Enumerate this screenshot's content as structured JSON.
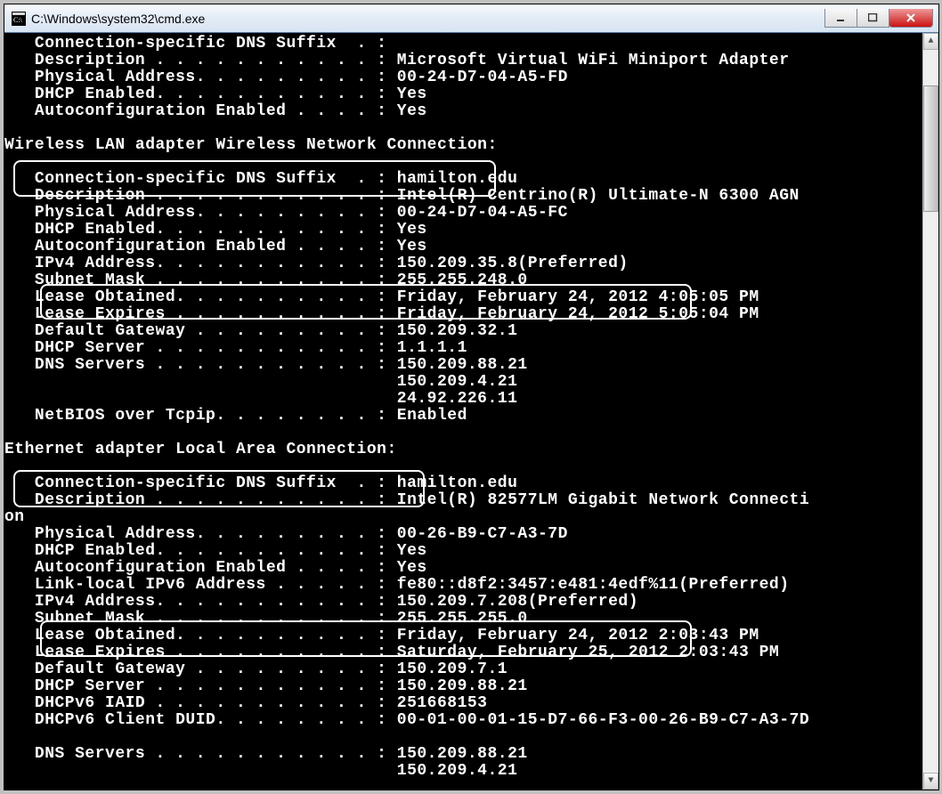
{
  "window": {
    "title": "C:\\Windows\\system32\\cmd.exe"
  },
  "console": {
    "lines": [
      "   Connection-specific DNS Suffix  . :",
      "   Description . . . . . . . . . . . : Microsoft Virtual WiFi Miniport Adapter",
      "   Physical Address. . . . . . . . . : 00-24-D7-04-A5-FD",
      "   DHCP Enabled. . . . . . . . . . . : Yes",
      "   Autoconfiguration Enabled . . . . : Yes",
      "",
      "Wireless LAN adapter Wireless Network Connection:",
      "",
      "   Connection-specific DNS Suffix  . : hamilton.edu",
      "   Description . . . . . . . . . . . : Intel(R) Centrino(R) Ultimate-N 6300 AGN",
      "   Physical Address. . . . . . . . . : 00-24-D7-04-A5-FC",
      "   DHCP Enabled. . . . . . . . . . . : Yes",
      "   Autoconfiguration Enabled . . . . : Yes",
      "   IPv4 Address. . . . . . . . . . . : 150.209.35.8(Preferred)",
      "   Subnet Mask . . . . . . . . . . . : 255.255.248.0",
      "   Lease Obtained. . . . . . . . . . : Friday, February 24, 2012 4:05:05 PM",
      "   Lease Expires . . . . . . . . . . : Friday, February 24, 2012 5:05:04 PM",
      "   Default Gateway . . . . . . . . . : 150.209.32.1",
      "   DHCP Server . . . . . . . . . . . : 1.1.1.1",
      "   DNS Servers . . . . . . . . . . . : 150.209.88.21",
      "                                       150.209.4.21",
      "                                       24.92.226.11",
      "   NetBIOS over Tcpip. . . . . . . . : Enabled",
      "",
      "Ethernet adapter Local Area Connection:",
      "",
      "   Connection-specific DNS Suffix  . : hamilton.edu",
      "   Description . . . . . . . . . . . : Intel(R) 82577LM Gigabit Network Connecti",
      "on",
      "   Physical Address. . . . . . . . . : 00-26-B9-C7-A3-7D",
      "   DHCP Enabled. . . . . . . . . . . : Yes",
      "   Autoconfiguration Enabled . . . . : Yes",
      "   Link-local IPv6 Address . . . . . : fe80::d8f2:3457:e481:4edf%11(Preferred)",
      "   IPv4 Address. . . . . . . . . . . : 150.209.7.208(Preferred)",
      "   Subnet Mask . . . . . . . . . . . : 255.255.255.0",
      "   Lease Obtained. . . . . . . . . . : Friday, February 24, 2012 2:03:43 PM",
      "   Lease Expires . . . . . . . . . . : Saturday, February 25, 2012 2:03:43 PM",
      "   Default Gateway . . . . . . . . . : 150.209.7.1",
      "   DHCP Server . . . . . . . . . . . : 150.209.88.21",
      "   DHCPv6 IAID . . . . . . . . . . . : 251668153",
      "   DHCPv6 Client DUID. . . . . . . . : 00-01-00-01-15-D7-66-F3-00-26-B9-C7-A3-7D",
      "",
      "   DNS Servers . . . . . . . . . . . : 150.209.88.21",
      "                                       150.209.4.21"
    ]
  }
}
